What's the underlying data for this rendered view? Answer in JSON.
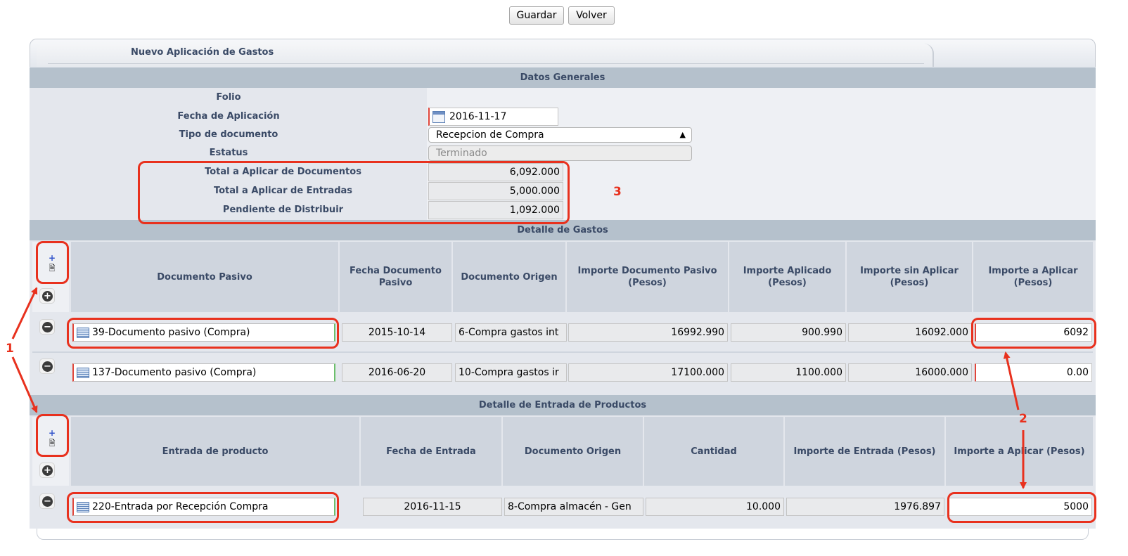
{
  "toolbar": {
    "save_label": "Guardar",
    "back_label": "Volver"
  },
  "tab": {
    "title": "Nuevo Aplicación de Gastos"
  },
  "general": {
    "section_title": "Datos Generales",
    "folio_label": "Folio",
    "folio_value": "",
    "fecha_label": "Fecha de Aplicación",
    "fecha_value": "2016-11-17",
    "tipo_label": "Tipo de documento",
    "tipo_value": "Recepcion de Compra",
    "estatus_label": "Estatus",
    "estatus_value": "Terminado",
    "total_docs_label": "Total a Aplicar de Documentos",
    "total_docs_value": "6,092.000",
    "total_entradas_label": "Total a Aplicar de Entradas",
    "total_entradas_value": "5,000.000",
    "pendiente_label": "Pendiente de Distribuir",
    "pendiente_value": "1,092.000"
  },
  "gastos": {
    "section_title": "Detalle de Gastos",
    "columns": [
      "Documento Pasivo",
      "Fecha Documento Pasivo",
      "Documento Origen",
      "Importe Documento Pasivo (Pesos)",
      "Importe Aplicado (Pesos)",
      "Importe sin Aplicar (Pesos)",
      "Importe a Aplicar (Pesos)"
    ],
    "rows": [
      {
        "doc": "39-Documento pasivo (Compra)",
        "fecha": "2015-10-14",
        "origen": "6-Compra gastos int",
        "importe": "16992.990",
        "aplicado": "900.990",
        "sin_aplicar": "16092.000",
        "a_aplicar": "6092"
      },
      {
        "doc": "137-Documento pasivo (Compra)",
        "fecha": "2016-06-20",
        "origen": "10-Compra gastos ir",
        "importe": "17100.000",
        "aplicado": "1100.000",
        "sin_aplicar": "16000.000",
        "a_aplicar": "0.00"
      }
    ]
  },
  "entradas": {
    "section_title": "Detalle de Entrada de Productos",
    "columns": [
      "Entrada de producto",
      "Fecha de Entrada",
      "Documento Origen",
      "Cantidad",
      "Importe de Entrada (Pesos)",
      "Importe a Aplicar (Pesos)"
    ],
    "rows": [
      {
        "entrada": "220-Entrada por Recepción Compra",
        "fecha": "2016-11-15",
        "origen": "8-Compra almacén - Gen",
        "cantidad": "10.000",
        "importe": "1976.897",
        "a_aplicar": "5000"
      }
    ]
  },
  "annotations": {
    "n1": "1",
    "n2": "2",
    "n3": "3"
  },
  "icons": {
    "add": "plus-document-icon",
    "add_row": "plus-circle-icon",
    "remove_row": "minus-circle-icon",
    "list": "list-icon",
    "calendar": "calendar-icon"
  },
  "colors": {
    "highlight": "#e8311e",
    "section_bar": "#b5c1cc",
    "panel": "#e4e7ed",
    "header": "#cfd5de"
  }
}
